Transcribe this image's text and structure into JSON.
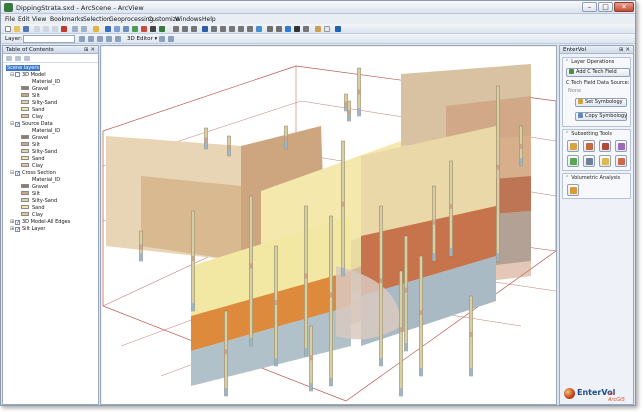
{
  "window": {
    "title": "DippingStrata.sxd - ArcScene - ArcView",
    "minimize": "–",
    "maximize": "□",
    "close": "✕"
  },
  "menu": [
    "File",
    "Edit",
    "View",
    "Bookmarks",
    "Selection",
    "Geoprocessing",
    "Customize",
    "Windows",
    "Help"
  ],
  "toolbar": {
    "layer_label": "Layer:",
    "layer_value": "",
    "editor_label": "3D Editor ▾"
  },
  "toc": {
    "title": "Table of Contents",
    "pin": "⊞ ✕",
    "root": "Scene layers",
    "layers": [
      {
        "name": "3D Model",
        "checked": false,
        "field": "Material_ID",
        "classes": [
          {
            "label": "Gravel",
            "color": "#8c7f6e"
          },
          {
            "label": "Silt",
            "color": "#c9a78a"
          },
          {
            "label": "Silty-Sand",
            "color": "#ded5a4"
          },
          {
            "label": "Sand",
            "color": "#f2e7a8"
          },
          {
            "label": "Clay",
            "color": "#e6c39d"
          }
        ]
      },
      {
        "name": "Source Data",
        "checked": true,
        "field": "Material_ID",
        "classes": [
          {
            "label": "Gravel",
            "color": "#8c7f6e"
          },
          {
            "label": "Silt",
            "color": "#c9a78a"
          },
          {
            "label": "Silty-Sand",
            "color": "#ded5a4"
          },
          {
            "label": "Sand",
            "color": "#f2e7a8"
          },
          {
            "label": "Clay",
            "color": "#e6c39d"
          }
        ]
      },
      {
        "name": "Cross Section",
        "checked": true,
        "field": "Material_ID",
        "classes": [
          {
            "label": "Gravel",
            "color": "#8c7f6e"
          },
          {
            "label": "Silt",
            "color": "#c9a78a"
          },
          {
            "label": "Silty-Sand",
            "color": "#ded5a4"
          },
          {
            "label": "Sand",
            "color": "#f2e7a8"
          },
          {
            "label": "Clay",
            "color": "#e6c39d"
          }
        ]
      },
      {
        "name": "3D Model-All Edges",
        "checked": true,
        "field": "",
        "classes": []
      },
      {
        "name": "Silt Layer",
        "checked": true,
        "field": "",
        "classes": []
      }
    ]
  },
  "entervol": {
    "title": "EnterVol",
    "pin": "⊞ ✕",
    "layer_ops": {
      "header": "Layer Operations",
      "add_button": "Add C Tech Field",
      "source_label": "C Tech Field Data Source:",
      "source_value": "None",
      "set_symbology": "Set Symbology",
      "copy_symbology": "Copy Symbology"
    },
    "subsetting": {
      "header": "Subsetting Tools"
    },
    "volumetric": {
      "header": "Volumetric Analysis"
    },
    "logo_name": "EnterVol",
    "logo_suffix": "for ArcGIS"
  }
}
